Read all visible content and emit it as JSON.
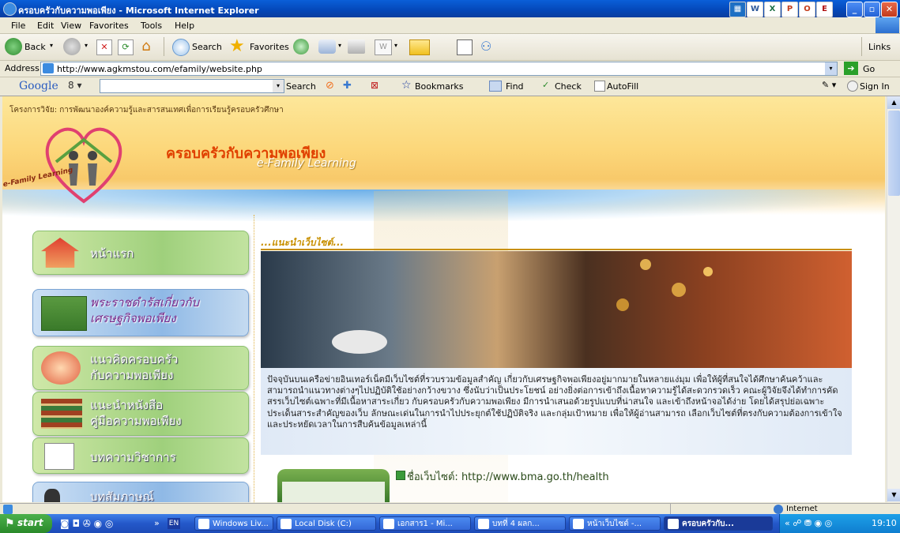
{
  "window": {
    "title": "ครอบครัวกับความพอเพียง - Microsoft Internet Explorer"
  },
  "menu": [
    "File",
    "Edit",
    "View",
    "Favorites",
    "Tools",
    "Help"
  ],
  "toolbar": {
    "back": "Back",
    "search": "Search",
    "favorites": "Favorites",
    "links": "Links"
  },
  "address": {
    "label": "Address",
    "url": "http://www.agkmstou.com/efamily/website.php",
    "go": "Go"
  },
  "googlebar": {
    "logo": "Google",
    "search_btn": "Search",
    "bookmarks": "Bookmarks",
    "find": "Find",
    "check": "Check",
    "autofill": "AutoFill",
    "signin": "Sign In"
  },
  "page": {
    "project_title": "โครงการวิจัย: การพัฒนาองค์ความรู้และสารสนเทศเพื่อการเรียนรู้ครอบครัวศึกษา",
    "site_title": "ครอบครัวกับความพอเพียง",
    "site_subtitle": "e-Family Learning",
    "logo_text": "e-Family Learning",
    "nav": [
      {
        "label": "หน้าแรก"
      },
      {
        "label": "พระราชดำรัสเกี่ยวกับ\nเศรษฐกิจพอเพียง"
      },
      {
        "label": "แนวคิดครอบครัว\nกับความพอเพียง"
      },
      {
        "label": "แนะนำหนังสือ\nคู่มือความพอเพียง"
      },
      {
        "label": "บทความวิชาการ"
      },
      {
        "label": "บทสัมภาษณ์"
      }
    ],
    "section_heading": "...แนะนำเว็บไซต์...",
    "intro": "ปัจจุบันบนเครือข่ายอินเทอร์เน็ตมีเว็บไซต์ที่รวบรวมข้อมูลสำคัญ เกี่ยวกับเศรษฐกิจพอเพียงอยู่มากมายในหลายแง่มุม เพื่อให้ผู้ที่สนใจได้ศึกษาค้นคว้าและสามารถนำแนวทางต่างๆไปปฏิบัติใช้อย่างกว้างขวาง ซึ่งนับว่าเป็นประโยชน์ อย่างยิ่งต่อการเข้าถึงเนื้อหาความรู้ได้สะดวกรวดเร็ว คณะผู้วิจัยจึงได้ทำการคัดสรรเว็บไซต์เฉพาะที่มีเนื้อหาสาระเกี่ยว กับครอบครัวกับความพอเพียง มีการนำเสนอด้วยรูปแบบที่น่าสนใจ และเข้าถึงหน้าจอได้ง่าย โดยได้สรุปย่อเฉพาะ ประเด็นสาระสำคัญของเว็บ ลักษณะเด่นในการนำไปประยุกต์ใช้ปฏิบัติจริง และกลุ่มเป้าหมาย เพื่อให้ผู้อ่านสามารถ เลือกเว็บไซต์ที่ตรงกับความต้องการเข้าใจและประหยัดเวลาในการสืบค้นข้อมูลเหล่านี้",
    "website_item": "ชื่อเว็บไซต์: http://www.bma.go.th/health"
  },
  "status": {
    "zone": "Internet"
  },
  "taskbar": {
    "start": "start",
    "lang": "EN",
    "tasks": [
      "Windows Liv...",
      "Local Disk (C:)",
      "เอกสาร1 - Mi...",
      "บทที่ 4 ผลก...",
      "หน้าเว็บไซต์ -...",
      "ครอบครัวกับ..."
    ],
    "clock": "19:10"
  },
  "colors": {
    "title_bar": "#0447b8",
    "heading_gold": "#c8a000",
    "taskbar": "#2458c9",
    "start_green": "#3c9a3c"
  }
}
